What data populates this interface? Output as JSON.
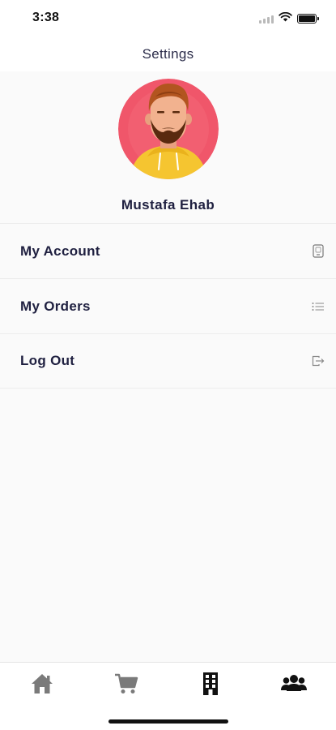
{
  "status_bar": {
    "time": "3:38"
  },
  "header": {
    "title": "Settings"
  },
  "profile": {
    "name": "Mustafa Ehab"
  },
  "menu": {
    "items": [
      {
        "label": "My Account",
        "icon": "phone-device-icon"
      },
      {
        "label": "My Orders",
        "icon": "list-icon"
      },
      {
        "label": "Log Out",
        "icon": "logout-icon"
      }
    ]
  },
  "tab_bar": {
    "tabs": [
      {
        "icon": "home-icon"
      },
      {
        "icon": "cart-icon"
      },
      {
        "icon": "building-icon"
      },
      {
        "icon": "users-icon",
        "active": true
      }
    ]
  },
  "colors": {
    "text_primary": "#1f2040",
    "tab_inactive": "#7a7a7a",
    "tab_active": "#111111",
    "avatar_bg": "#f0566a",
    "hoodie": "#f5c530"
  }
}
